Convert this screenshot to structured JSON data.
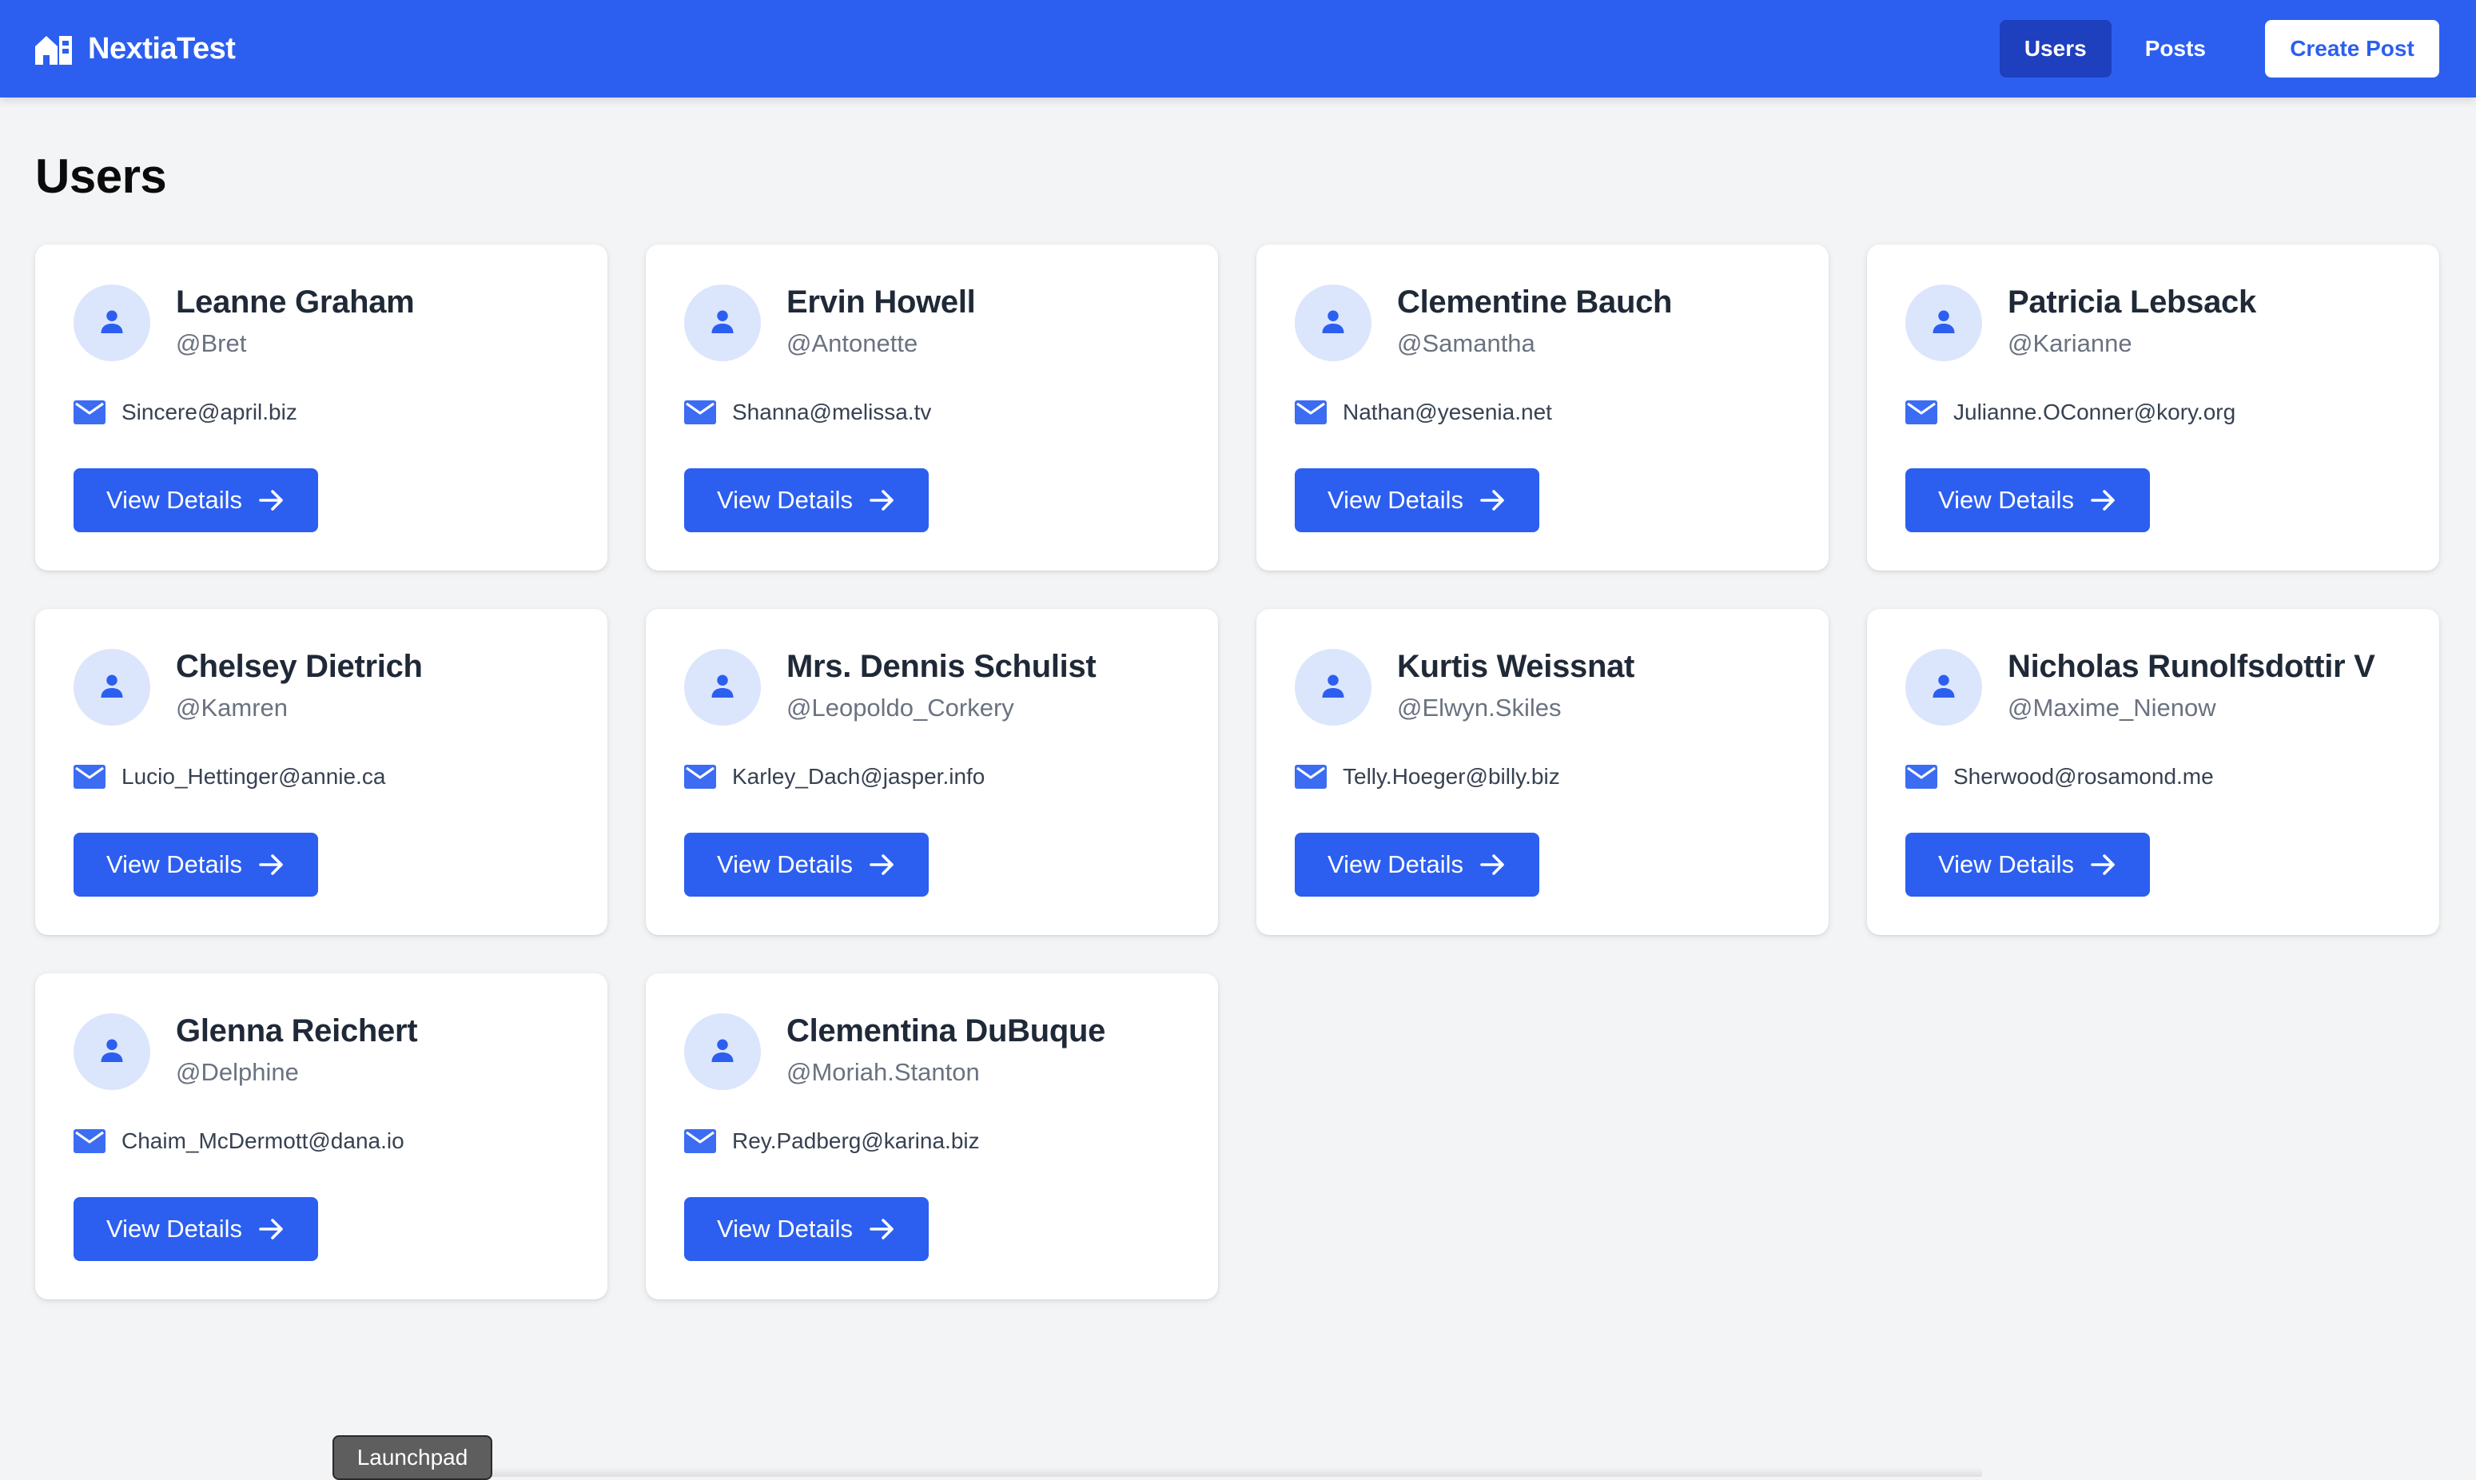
{
  "app": {
    "brand": "NextiaTest",
    "brand_icon": "home-icon",
    "accent_color": "#2c5ff0",
    "active_nav_color": "#1e3fbe"
  },
  "nav": {
    "users": "Users",
    "posts": "Posts",
    "create_post": "Create Post",
    "active": "Users"
  },
  "page": {
    "title": "Users"
  },
  "users": [
    {
      "name": "Leanne Graham",
      "username": "@Bret",
      "email": "Sincere@april.biz",
      "button": "View Details"
    },
    {
      "name": "Ervin Howell",
      "username": "@Antonette",
      "email": "Shanna@melissa.tv",
      "button": "View Details"
    },
    {
      "name": "Clementine Bauch",
      "username": "@Samantha",
      "email": "Nathan@yesenia.net",
      "button": "View Details"
    },
    {
      "name": "Patricia Lebsack",
      "username": "@Karianne",
      "email": "Julianne.OConner@kory.org",
      "button": "View Details"
    },
    {
      "name": "Chelsey Dietrich",
      "username": "@Kamren",
      "email": "Lucio_Hettinger@annie.ca",
      "button": "View Details"
    },
    {
      "name": "Mrs. Dennis Schulist",
      "username": "@Leopoldo_Corkery",
      "email": "Karley_Dach@jasper.info",
      "button": "View Details"
    },
    {
      "name": "Kurtis Weissnat",
      "username": "@Elwyn.Skiles",
      "email": "Telly.Hoeger@billy.biz",
      "button": "View Details"
    },
    {
      "name": "Nicholas Runolfsdottir V",
      "username": "@Maxime_Nienow",
      "email": "Sherwood@rosamond.me",
      "button": "View Details"
    },
    {
      "name": "Glenna Reichert",
      "username": "@Delphine",
      "email": "Chaim_McDermott@dana.io",
      "button": "View Details"
    },
    {
      "name": "Clementina DuBuque",
      "username": "@Moriah.Stanton",
      "email": "Rey.Padberg@karina.biz",
      "button": "View Details"
    }
  ],
  "icons": {
    "avatar": "person-icon",
    "email": "mail-icon",
    "button": "arrow-right-icon"
  },
  "dock": {
    "tooltip": "Launchpad"
  }
}
